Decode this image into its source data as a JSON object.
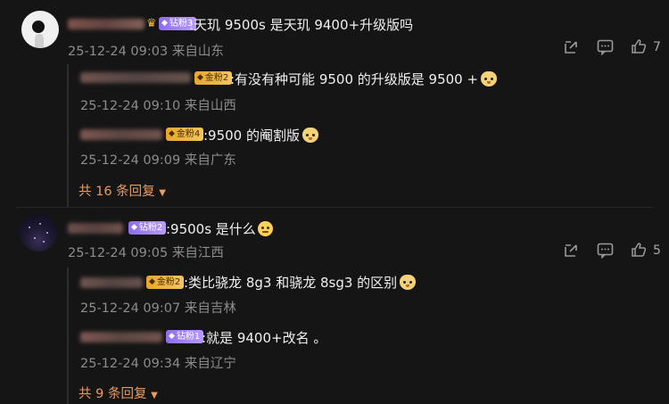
{
  "comments": [
    {
      "badge": "钻粉3",
      "text": ":天玑 9500s 是天玑 9400+升级版吗",
      "meta": "25-12-24 09:03 来自山东",
      "likes": "7",
      "replies": [
        {
          "badge": "金粉2",
          "text": ":有没有种可能 9500 的升级版是 9500 +",
          "meta": "25-12-24 09:10 来自山西"
        },
        {
          "badge": "金粉4",
          "text": ":9500 的阉割版",
          "meta": "25-12-24 09:09 来自广东"
        }
      ],
      "more": "共 16 条回复"
    },
    {
      "badge": "钻粉2",
      "text": ":9500s 是什么",
      "meta": "25-12-24 09:05 来自江西",
      "likes": "5",
      "replies": [
        {
          "badge": "金粉2",
          "text": ":类比骁龙 8g3 和骁龙 8sg3 的区别",
          "meta": "25-12-24 09:07 来自吉林"
        },
        {
          "badge": "钻粉1",
          "text": ":就是 9400+改名 。",
          "meta": "25-12-24 09:34 来自辽宁"
        }
      ],
      "more": "共 9 条回复"
    }
  ],
  "colors": {
    "background": "#151515",
    "more_link": "#e89b64",
    "gold_badge": "#e7a72a",
    "purple_badge": "#8e6cf0"
  },
  "icons": {
    "share": "share-icon",
    "comment": "comment-icon",
    "like": "thumbs-up-icon",
    "expand": "caret-down-icon"
  }
}
